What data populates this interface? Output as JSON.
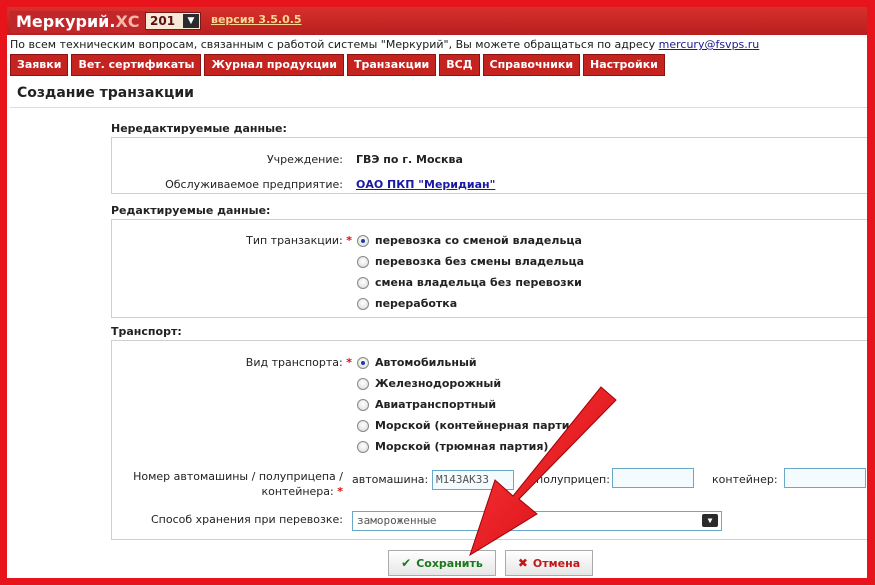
{
  "header": {
    "logo_main": "Меркурий.",
    "logo_xc": "ХС",
    "year_value": "201",
    "version_label": "версия 3.5.0.5",
    "support_text": "По всем техническим вопросам, связанным с работой системы \"Меркурий\", Вы можете обращаться по адресу ",
    "support_email": "mercury@fsvps.ru"
  },
  "nav": {
    "tabs": [
      "Заявки",
      "Вет. сертификаты",
      "Журнал продукции",
      "Транзакции",
      "ВСД",
      "Справочники",
      "Настройки"
    ]
  },
  "page": {
    "title": "Создание транзакции"
  },
  "readonly": {
    "heading": "Нередактируемые данные:",
    "institution_label": "Учреждение:",
    "institution_value": "ГВЭ по г. Москва",
    "enterprise_label": "Обслуживаемое предприятие:",
    "enterprise_value": "ОАО ПКП \"Меридиан\""
  },
  "editable": {
    "heading": "Редактируемые данные:",
    "type_label": "Тип транзакции:",
    "required_mark": "*",
    "options": [
      "перевозка со сменой владельца",
      "перевозка без смены владельца",
      "смена владельца без перевозки",
      "переработка"
    ],
    "selected_index": 0
  },
  "transport": {
    "heading": "Транспорт:",
    "kind_label": "Вид транспорта:",
    "options": [
      "Автомобильный",
      "Железнодорожный",
      "Авиатранспортный",
      "Морской (контейнерная партия)",
      "Морской (трюмная партия)"
    ],
    "selected_index": 0,
    "number_label_line1": "Номер автомашины / полуприцепа /",
    "number_label_line2": "контейнера:",
    "car_label": "автомашина:",
    "car_value": "М143АК33",
    "trailer_label": "полуприцеп:",
    "trailer_value": "",
    "container_label": "контейнер:",
    "container_value": "",
    "storage_label": "Способ хранения при перевозке:",
    "storage_value": "замороженные"
  },
  "actions": {
    "save_label": "Сохранить",
    "cancel_label": "Отмена"
  },
  "colors": {
    "border_red": "#e8141c",
    "header_red": "#c4231f",
    "link_blue": "#1a1aa0",
    "arrow_red": "#e8101a"
  }
}
